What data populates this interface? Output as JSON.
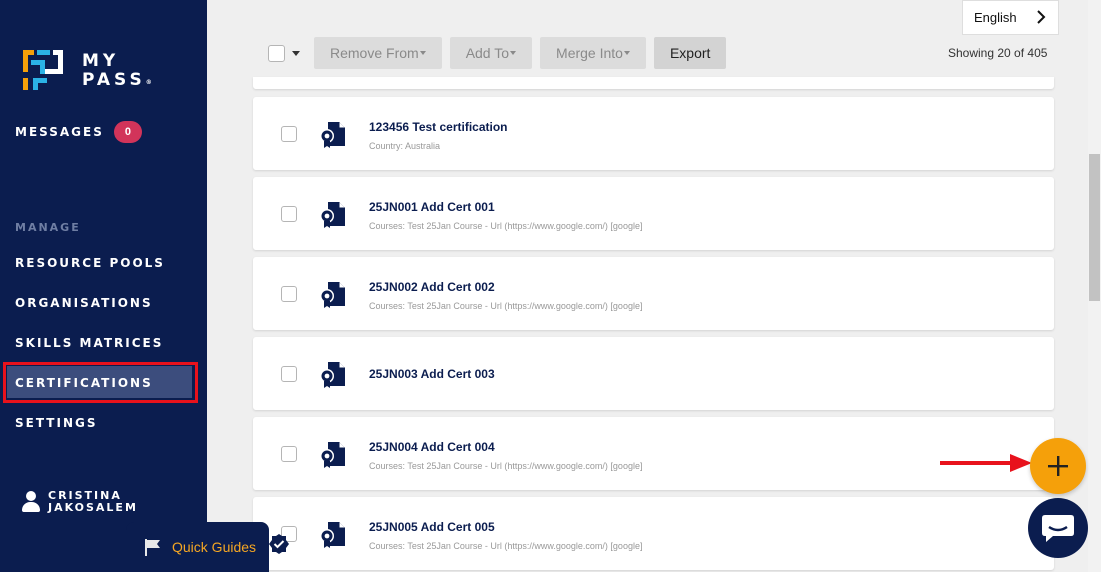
{
  "brand": {
    "line1": "MY",
    "line2": "PASS",
    "mark": "®"
  },
  "sidebar": {
    "messages": {
      "label": "MESSAGES",
      "count": "0"
    },
    "section_label": "MANAGE",
    "items": [
      {
        "label": "RESOURCE POOLS"
      },
      {
        "label": "ORGANISATIONS"
      },
      {
        "label": "SKILLS MATRICES"
      },
      {
        "label": "CERTIFICATIONS",
        "active": true
      },
      {
        "label": "SETTINGS"
      }
    ],
    "user": {
      "first": "CRISTINA",
      "last": "JAKOSALEM"
    }
  },
  "quick_guides": {
    "label": "Quick Guides"
  },
  "language": {
    "selected": "English"
  },
  "toolbar": {
    "remove_label": "Remove From",
    "add_label": "Add To",
    "merge_label": "Merge Into",
    "export_label": "Export",
    "showing": "Showing 20 of 405"
  },
  "certifications": [
    {
      "title": "123456 Test certification",
      "subtitle": "Country: Australia"
    },
    {
      "title": "25JN001 Add Cert 001",
      "subtitle": "Courses: Test 25Jan Course - Url (https://www.google.com/) [google]"
    },
    {
      "title": "25JN002 Add Cert 002",
      "subtitle": "Courses: Test 25Jan Course - Url (https://www.google.com/) [google]"
    },
    {
      "title": "25JN003 Add Cert 003",
      "subtitle": ""
    },
    {
      "title": "25JN004 Add Cert 004",
      "subtitle": "Courses: Test 25Jan Course - Url (https://www.google.com/) [google]"
    },
    {
      "title": "25JN005 Add Cert 005",
      "subtitle": "Courses: Test 25Jan Course - Url (https://www.google.com/) [google]"
    }
  ],
  "colors": {
    "sidebar_bg": "#0b1d4f",
    "active_item_bg": "#3c4d7d",
    "highlight_red": "#e8121c",
    "badge": "#d2345a",
    "fab": "#f5a00a",
    "quick_guides_text": "#f5a623"
  },
  "icons": {
    "certificate": "certificate-icon",
    "add": "plus-icon",
    "chat": "chat-icon",
    "flag": "flag-icon",
    "chevron": "chevron-right-icon",
    "user": "user-icon"
  }
}
